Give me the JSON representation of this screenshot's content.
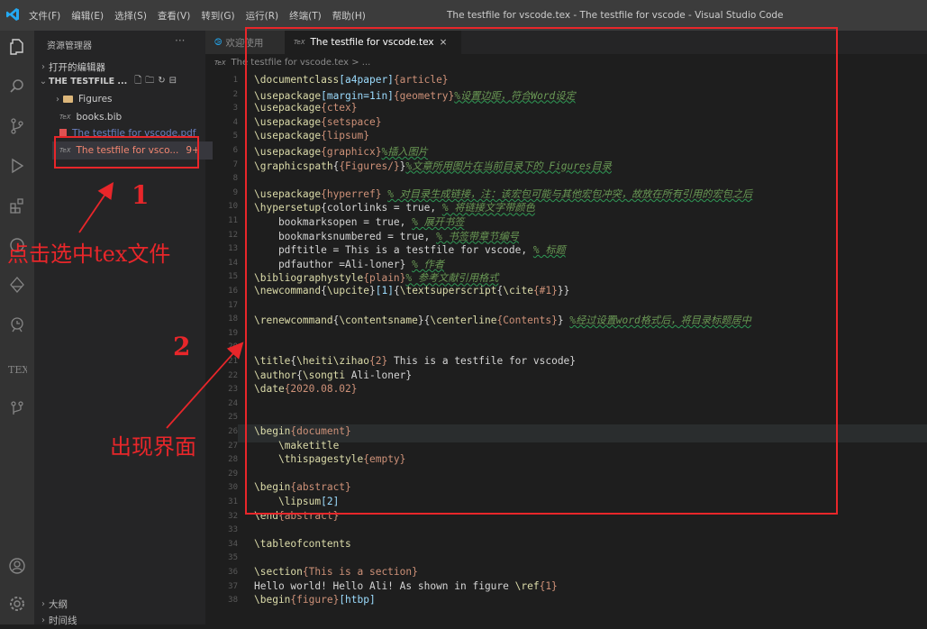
{
  "titlebar": {
    "menu": [
      "文件(F)",
      "编辑(E)",
      "选择(S)",
      "查看(V)",
      "转到(G)",
      "运行(R)",
      "终端(T)",
      "帮助(H)"
    ],
    "window_title": "The testfile for vscode.tex - The testfile for vscode - Visual Studio Code"
  },
  "activity_icons": [
    "explorer-icon",
    "search-icon",
    "source-control-icon",
    "run-debug-icon",
    "extensions-icon",
    "remote-icon",
    "testing-icon",
    "timeline-icon",
    "tex-icon",
    "git-graph-icon",
    "account-icon",
    "settings-gear-icon"
  ],
  "sidebar": {
    "title": "资源管理器",
    "more": "···",
    "open_editors": "打开的编辑器",
    "workspace": "THE TESTFILE ...",
    "items": [
      {
        "label": "Figures",
        "type": "folder"
      },
      {
        "label": "books.bib",
        "type": "tex"
      },
      {
        "label": "The testfile for vscode.pdf",
        "type": "pdf"
      },
      {
        "label": "The testfile for vsco...",
        "type": "tex",
        "badge": "9+"
      }
    ],
    "outline": "大纲",
    "timeline": "时间线"
  },
  "tabs": [
    {
      "label": "欢迎使用"
    },
    {
      "label": "The testfile for vscode.tex",
      "close": "×"
    }
  ],
  "breadcrumb": "The testfile for vscode.tex > ...",
  "editor": {
    "line_numbers": [
      "1",
      "2",
      "3",
      "4",
      "5",
      "6",
      "7",
      "8",
      "9",
      "10",
      "11",
      "12",
      "13",
      "14",
      "15",
      "16",
      "17",
      "18",
      "19",
      "20",
      "21",
      "22",
      "23",
      "24",
      "25",
      "26",
      "27",
      "28",
      "29",
      "30",
      "31",
      "32",
      "33",
      "34",
      "35",
      "36",
      "37",
      "38"
    ],
    "lines": [
      "\\documentclass[a4paper]{article}",
      "\\usepackage[margin=1in]{geometry}%设置边距，符合Word设定",
      "\\usepackage{ctex}",
      "\\usepackage{setspace}",
      "\\usepackage{lipsum}",
      "\\usepackage{graphicx}%插入图片",
      "\\graphicspath{{Figures/}}%文章所用图片在当前目录下的 Figures目录",
      "",
      "\\usepackage{hyperref} % 对目录生成链接，注：该宏包可能与其他宏包冲突，故放在所有引用的宏包之后",
      "\\hypersetup{colorlinks = true, % 将链接文字带颜色",
      "    bookmarksopen = true, % 展开书签",
      "    bookmarksnumbered = true, % 书签带章节编号",
      "    pdftitle = This is a testfile for vscode, % 标题",
      "    pdfauthor =Ali-loner} % 作者",
      "\\bibliographystyle{plain}% 参考文献引用格式",
      "\\newcommand{\\upcite}[1]{\\textsuperscript{\\cite{#1}}}",
      "",
      "\\renewcommand{\\contentsname}{\\centerline{Contents}} %经过设置word格式后，将目录标题居中",
      "",
      "",
      "\\title{\\heiti\\zihao{2} This is a testfile for vscode}",
      "\\author{\\songti Ali-loner}",
      "\\date{2020.08.02}",
      "",
      "",
      "\\begin{document}",
      "    \\maketitle",
      "    \\thispagestyle{empty}",
      "",
      "\\begin{abstract}",
      "    \\lipsum[2]",
      "\\end{abstract}",
      "",
      "\\tableofcontents",
      "",
      "\\section{This is a section}",
      "Hello world! Hello Ali! As shown in figure \\ref{1}",
      "\\begin{figure}[htbp]"
    ]
  },
  "annotations": {
    "step1_number": "1",
    "step1_text": "点击选中tex文件",
    "step2_number": "2",
    "step2_text": "出现界面"
  },
  "colors": {
    "annotation_red": "#e8262a",
    "editor_bg": "#1e1e1e",
    "sidebar_bg": "#252526"
  }
}
